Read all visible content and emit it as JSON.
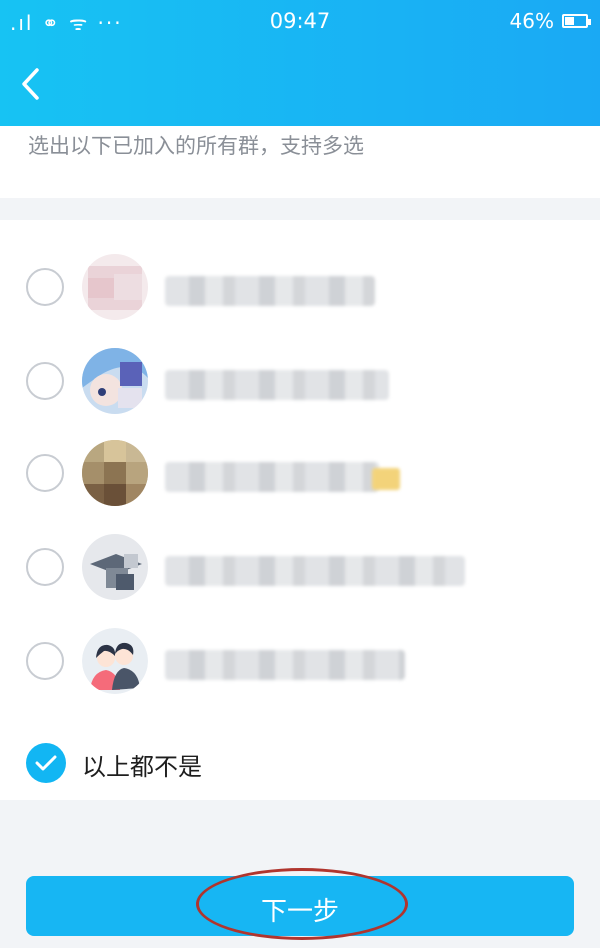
{
  "status_bar": {
    "signal": ".ıl ⚭ ᯤ ···",
    "time": "09:47",
    "battery": "46%",
    "battery_level": 0.46
  },
  "nav": {
    "back_icon": "chevron-left-icon"
  },
  "instruction": "选出以下已加入的所有群，支持多选",
  "groups": [
    {
      "avatar": "pink-blurred-avatar",
      "selected": false
    },
    {
      "avatar": "anime-character-avatar",
      "selected": false
    },
    {
      "avatar": "brown-blurred-avatar",
      "selected": false
    },
    {
      "avatar": "gray-graduation-avatar",
      "selected": false
    },
    {
      "avatar": "couple-default-avatar",
      "selected": false
    }
  ],
  "none_option": {
    "label": "以上都不是",
    "selected": true
  },
  "next_button": {
    "label": "下一步"
  },
  "colors": {
    "header": "#17c3f3",
    "accent": "#17b6f3",
    "annotation": "#b0352e"
  }
}
